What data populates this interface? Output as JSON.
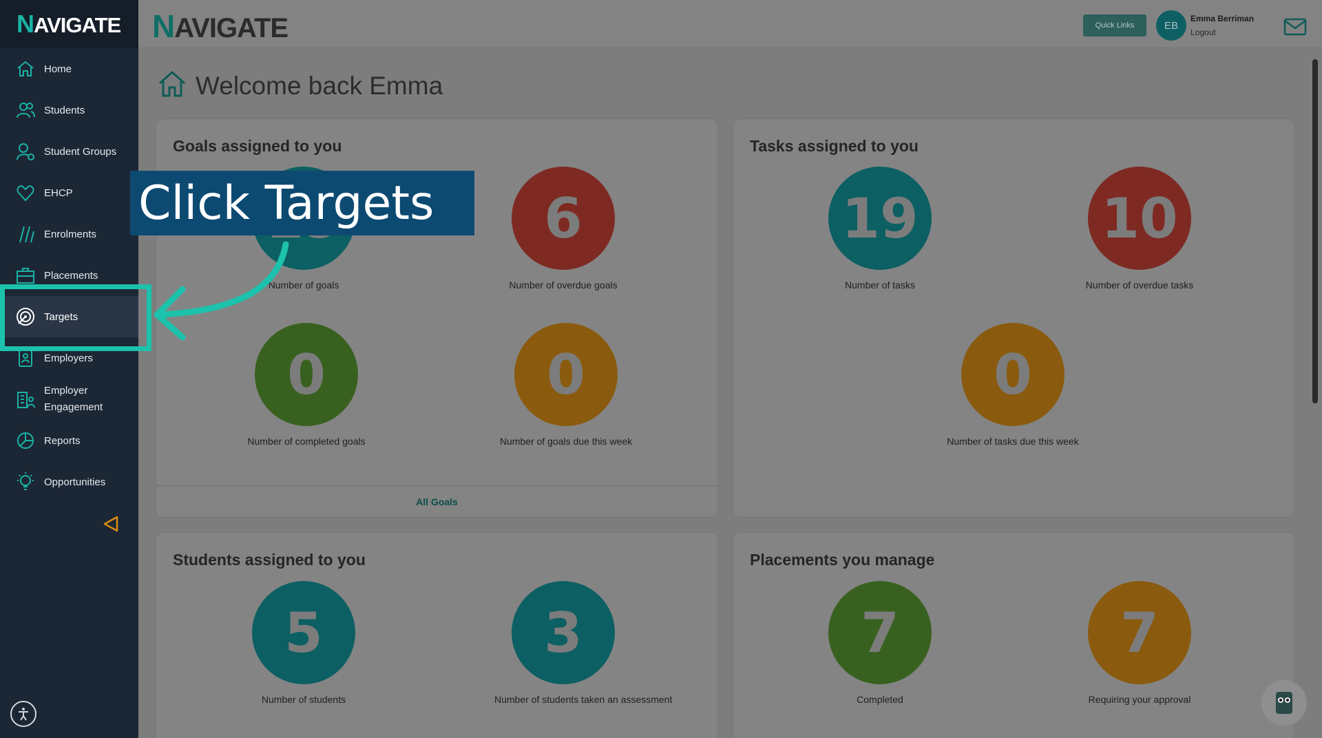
{
  "app": {
    "logo": "AVIGATE",
    "logo_letter": "N"
  },
  "sidebar": {
    "items": [
      {
        "label": "Home",
        "icon": "home-icon"
      },
      {
        "label": "Students",
        "icon": "users-icon"
      },
      {
        "label": "Student Groups",
        "icon": "user-group-icon"
      },
      {
        "label": "EHCP",
        "icon": "heart-icon"
      },
      {
        "label": "Enrolments",
        "icon": "slashes-icon"
      },
      {
        "label": "Placements",
        "icon": "briefcase-icon"
      },
      {
        "label": "Targets",
        "icon": "target-icon",
        "active": true
      },
      {
        "label": "Employers",
        "icon": "id-badge-icon"
      },
      {
        "label": "Employer Engagement",
        "icon": "building-icon"
      },
      {
        "label": "Reports",
        "icon": "pie-chart-icon"
      },
      {
        "label": "Opportunities",
        "icon": "lightbulb-icon"
      }
    ]
  },
  "header": {
    "quick_links": "Quick Links",
    "avatar_initials": "EB",
    "user_name": "Emma Berriman",
    "logout": "Logout"
  },
  "page": {
    "title": "Welcome back Emma"
  },
  "cards": {
    "goals": {
      "title": "Goals assigned to you",
      "stats": [
        {
          "value": "19",
          "label": "Number of goals",
          "color": "#0c5f62"
        },
        {
          "value": "6",
          "label": "Number of overdue goals",
          "color": "#7e2a22"
        },
        {
          "value": "0",
          "label": "Number of completed goals",
          "color": "#38611f"
        },
        {
          "value": "0",
          "label": "Number of goals due this week",
          "color": "#8a5b0e"
        }
      ],
      "footer": "All Goals"
    },
    "tasks": {
      "title": "Tasks assigned to you",
      "stats": [
        {
          "value": "19",
          "label": "Number of tasks",
          "color": "#0c5f62"
        },
        {
          "value": "10",
          "label": "Number of overdue tasks",
          "color": "#7e2a22"
        },
        {
          "value": "0",
          "label": "Number of tasks due this week",
          "color": "#8a5b0e"
        }
      ]
    },
    "students": {
      "title": "Students assigned to you",
      "stats": [
        {
          "value": "5",
          "label": "Number of students",
          "color": "#0c5f62"
        },
        {
          "value": "3",
          "label": "Number of students taken an assessment",
          "color": "#0c5f62"
        }
      ]
    },
    "placements": {
      "title": "Placements you manage",
      "stats": [
        {
          "value": "7",
          "label": "Completed",
          "color": "#38611f"
        },
        {
          "value": "7",
          "label": "Requiring your approval",
          "color": "#8a5b0e"
        }
      ]
    }
  },
  "callout": {
    "text": "Click Targets"
  },
  "colors": {
    "accent": "#1dc2ac",
    "sidebar_bg": "#1c2735",
    "callout_bg": "#0d4a72"
  }
}
